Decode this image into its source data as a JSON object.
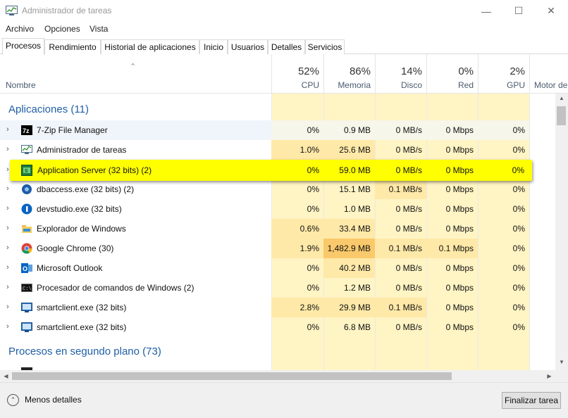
{
  "window": {
    "title": "Administrador de tareas"
  },
  "menu": [
    "Archivo",
    "Opciones",
    "Vista"
  ],
  "tabs": [
    "Procesos",
    "Rendimiento",
    "Historial de aplicaciones",
    "Inicio",
    "Usuarios",
    "Detalles",
    "Servicios"
  ],
  "header": {
    "name_label": "Nombre",
    "columns": [
      {
        "pct": "52%",
        "label": "CPU"
      },
      {
        "pct": "86%",
        "label": "Memoria"
      },
      {
        "pct": "14%",
        "label": "Disco"
      },
      {
        "pct": "0%",
        "label": "Red"
      },
      {
        "pct": "2%",
        "label": "GPU"
      },
      {
        "pct": "",
        "label": "Motor de"
      }
    ]
  },
  "groups": {
    "apps_title": "Aplicaciones (11)",
    "background_title": "Procesos en segundo plano (73)"
  },
  "rows": [
    {
      "name": "7-Zip File Manager",
      "icon": "7zip-icon",
      "cpu": "0%",
      "mem": "0.9 MB",
      "disk": "0 MB/s",
      "net": "0 Mbps",
      "gpu": "0%"
    },
    {
      "name": "Administrador de tareas",
      "icon": "task-manager-icon",
      "cpu": "1.0%",
      "mem": "25.6 MB",
      "disk": "0 MB/s",
      "net": "0 Mbps",
      "gpu": "0%"
    },
    {
      "name": "Application Server (32 bits) (2)",
      "icon": "application-server-icon",
      "cpu": "0%",
      "mem": "59.0 MB",
      "disk": "0 MB/s",
      "net": "0 Mbps",
      "gpu": "0%"
    },
    {
      "name": "dbaccess.exe (32 bits) (2)",
      "icon": "dbaccess-icon",
      "cpu": "0%",
      "mem": "15.1 MB",
      "disk": "0.1 MB/s",
      "net": "0 Mbps",
      "gpu": "0%"
    },
    {
      "name": "devstudio.exe (32 bits)",
      "icon": "devstudio-icon",
      "cpu": "0%",
      "mem": "1.0 MB",
      "disk": "0 MB/s",
      "net": "0 Mbps",
      "gpu": "0%"
    },
    {
      "name": "Explorador de Windows",
      "icon": "folder-icon",
      "cpu": "0.6%",
      "mem": "33.4 MB",
      "disk": "0 MB/s",
      "net": "0 Mbps",
      "gpu": "0%"
    },
    {
      "name": "Google Chrome (30)",
      "icon": "chrome-icon",
      "cpu": "1.9%",
      "mem": "1,482.9 MB",
      "disk": "0.1 MB/s",
      "net": "0.1 Mbps",
      "gpu": "0%"
    },
    {
      "name": "Microsoft Outlook",
      "icon": "outlook-icon",
      "cpu": "0%",
      "mem": "40.2 MB",
      "disk": "0 MB/s",
      "net": "0 Mbps",
      "gpu": "0%"
    },
    {
      "name": "Procesador de comandos de Windows (2)",
      "icon": "cmd-icon",
      "cpu": "0%",
      "mem": "1.2 MB",
      "disk": "0 MB/s",
      "net": "0 Mbps",
      "gpu": "0%"
    },
    {
      "name": "smartclient.exe (32 bits)",
      "icon": "smartclient-icon",
      "cpu": "2.8%",
      "mem": "29.9 MB",
      "disk": "0.1 MB/s",
      "net": "0 Mbps",
      "gpu": "0%"
    },
    {
      "name": "smartclient.exe (32 bits)",
      "icon": "smartclient-icon",
      "cpu": "0%",
      "mem": "6.8 MB",
      "disk": "0 MB/s",
      "net": "0 Mbps",
      "gpu": "0%"
    }
  ],
  "footer": {
    "less_details": "Menos detalles",
    "end_task": "Finalizar tarea"
  },
  "colors": {
    "heat_light": "#fff4c4",
    "heat_mid": "#ffe9a8",
    "heat_high": "#f9c96b",
    "highlight": "#ffff00",
    "group_title": "#1f5fa6"
  }
}
